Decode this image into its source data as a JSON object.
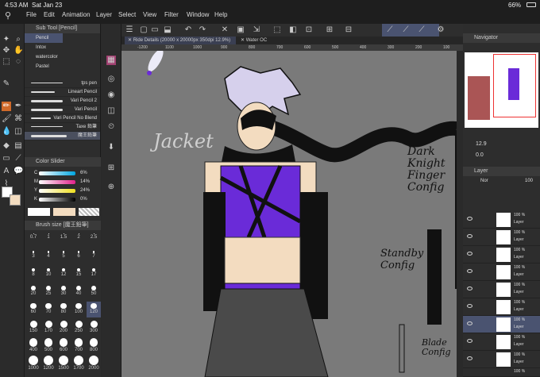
{
  "status": {
    "time": "4:53 AM",
    "date": "Sat Jan 23",
    "battery": "66%"
  },
  "menu": [
    "File",
    "Edit",
    "Animation",
    "Layer",
    "Select",
    "View",
    "Filter",
    "Window",
    "Help"
  ],
  "subtool": {
    "title": "Sub Tool [Pencil]",
    "tabs": [
      "Pencil",
      "Intox",
      "watercolor",
      "Pastel"
    ],
    "brushes": [
      "tps pen",
      "Lineart Pencil",
      "Vari Pencil 2",
      "Vari Pencil",
      "Vari Pencil No Blend",
      "Taxe 鉛筆",
      "魔王鉛筆"
    ]
  },
  "colorslider": {
    "title": "Color Slider",
    "channels": [
      {
        "label": "C",
        "value": "6%"
      },
      {
        "label": "M",
        "value": "14%"
      },
      {
        "label": "Y",
        "value": "24%"
      },
      {
        "label": "K",
        "value": "0%"
      }
    ]
  },
  "brushsize": {
    "title": "Brush size [魔王鉛筆]",
    "sizes": [
      "0.7",
      "1",
      "1.5",
      "2",
      "2.5",
      "3",
      "4",
      "5",
      "6",
      "7",
      "8",
      "10",
      "12",
      "15",
      "17",
      "20",
      "25",
      "30",
      "40",
      "50",
      "60",
      "70",
      "80",
      "100",
      "120",
      "150",
      "170",
      "200",
      "250",
      "300",
      "400",
      "500",
      "600",
      "700",
      "800",
      "1000",
      "1200",
      "1500",
      "1700",
      "2000"
    ]
  },
  "doc_tabs": [
    "Ride Details (20000 x 20000px 350dpi 12.9%)",
    "Water OC"
  ],
  "ruler_ticks": [
    "-1200",
    "1100",
    "1000",
    "900",
    "800",
    "700",
    "600",
    "500",
    "400",
    "300",
    "200",
    "100"
  ],
  "canvas_text": {
    "jacket": "Jacket",
    "dark_knight": "Dark\nKnight\nFinger\nConfig",
    "standby": "Standby\nConfig",
    "blade": "Blade\nConfig"
  },
  "navigator": {
    "title": "Navigator",
    "zoom": "12.9",
    "angle": "0.0"
  },
  "layer": {
    "title": "Layer",
    "blend": "Nor",
    "opacity": "100",
    "rows": [
      {
        "pct": "100 %",
        "name": "Layer"
      },
      {
        "pct": "100 %",
        "name": "Layer"
      },
      {
        "pct": "100 %",
        "name": "Layer"
      },
      {
        "pct": "100 %",
        "name": "Layer"
      },
      {
        "pct": "100 %",
        "name": "Layer"
      },
      {
        "pct": "100 %",
        "name": "Layer"
      },
      {
        "pct": "100 %",
        "name": "Layer"
      },
      {
        "pct": "100 %",
        "name": "Layer"
      },
      {
        "pct": "100 %",
        "name": "Layer"
      }
    ],
    "folder": {
      "pct": "100 %",
      "name": "Fold"
    }
  },
  "colors": {
    "accent": "#4a5370",
    "purple": "#6a2bd8",
    "skin": "#f3dcc0",
    "canvas": "#7a7a7a"
  }
}
